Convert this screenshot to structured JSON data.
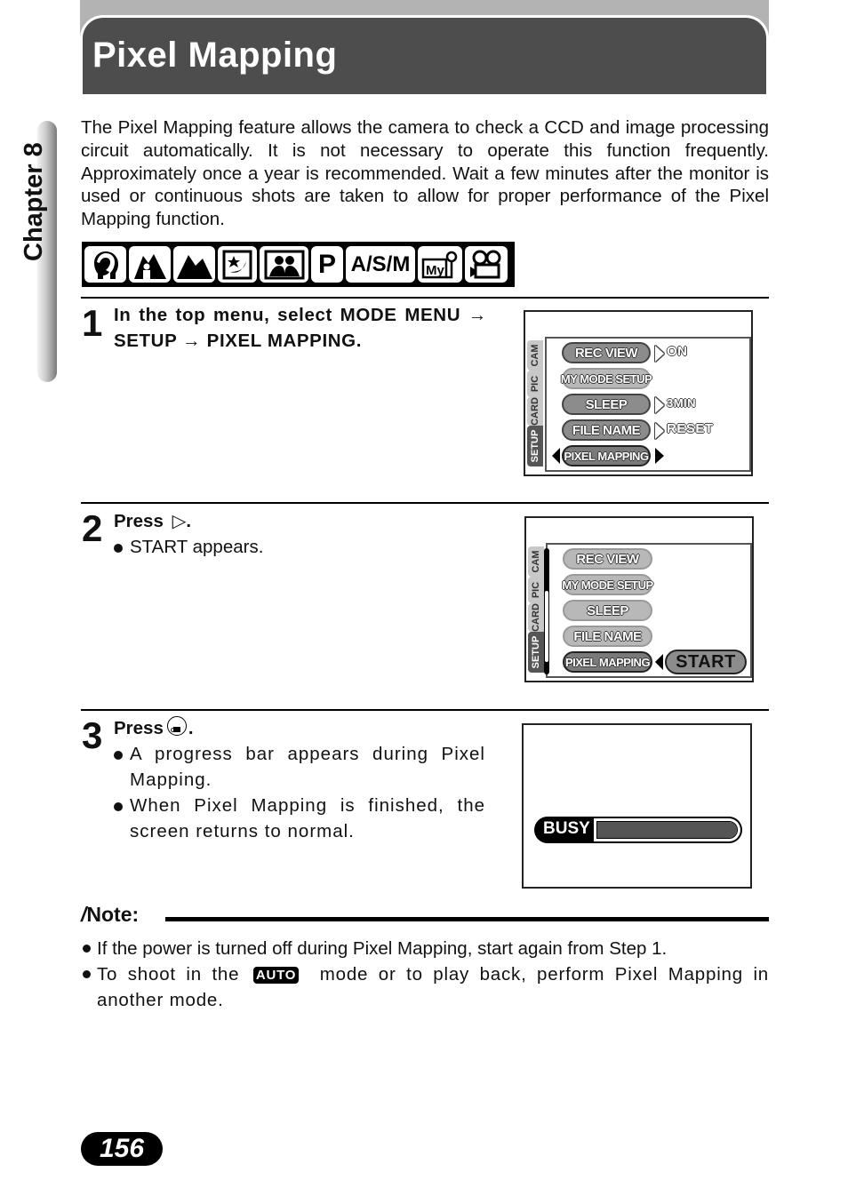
{
  "header": {
    "title": "Pixel Mapping"
  },
  "chapter": {
    "label": "Chapter 8"
  },
  "intro": "The Pixel Mapping feature allows the camera to check a CCD and image processing circuit automatically. It is not necessary to operate this function frequently. Approximately once a year is recommended. Wait a few minutes after the monitor is used or continuous shots are taken to allow for proper performance of the Pixel Mapping function.",
  "mode_icons": [
    {
      "icon": "portrait-icon"
    },
    {
      "icon": "landscape-portrait-icon"
    },
    {
      "icon": "landscape-icon"
    },
    {
      "icon": "night-scene-icon"
    },
    {
      "icon": "self-portrait-icon"
    },
    {
      "icon": "program-mode-icon",
      "text": "P"
    },
    {
      "icon": "asm-mode-icon",
      "text": "A/S/M"
    },
    {
      "icon": "my-mode-icon",
      "text": "My"
    },
    {
      "icon": "movie-icon"
    }
  ],
  "steps": [
    {
      "number": "1",
      "title": "In the top menu, select MODE MENU → SETUP → PIXEL MAPPING.",
      "bullets": [],
      "screen": {
        "tabs": [
          "CAM",
          "PIC",
          "CARD",
          "SETUP"
        ],
        "active_tab": "SETUP",
        "items": [
          {
            "label": "REC VIEW",
            "value": "ON"
          },
          {
            "label": "MY MODE SETUP",
            "value": ""
          },
          {
            "label": "SLEEP",
            "value": "3MIN"
          },
          {
            "label": "FILE NAME",
            "value": "RESET"
          },
          {
            "label": "PIXEL MAPPING",
            "value": ""
          }
        ],
        "selected": "PIXEL MAPPING"
      }
    },
    {
      "number": "2",
      "title_prefix": "Press",
      "title_suffix": ".",
      "button_glyph": "▷",
      "bullets": [
        "START appears."
      ],
      "screen": {
        "tabs": [
          "CAM",
          "PIC",
          "CARD",
          "SETUP"
        ],
        "active_tab": "SETUP",
        "items": [
          {
            "label": "REC VIEW"
          },
          {
            "label": "MY MODE SETUP"
          },
          {
            "label": "SLEEP"
          },
          {
            "label": "FILE NAME"
          },
          {
            "label": "PIXEL MAPPING"
          }
        ],
        "selected": "PIXEL MAPPING",
        "action": "START"
      }
    },
    {
      "number": "3",
      "title_prefix": "Press",
      "title_suffix": ".",
      "button_icon": "ok-menu-button-icon",
      "bullets": [
        "A progress bar appears during Pixel Mapping.",
        "When Pixel Mapping is finished, the screen returns to normal."
      ],
      "screen": {
        "status_label": "BUSY",
        "progress_percent": 100
      }
    }
  ],
  "note": {
    "heading": "Note:",
    "items": [
      "If the power is turned off during Pixel Mapping, start again from Step 1.",
      {
        "before": "To shoot in the",
        "badge": "AUTO",
        "after": "mode or to play back, perform Pixel Mapping in another mode."
      }
    ]
  },
  "page_number": "156"
}
